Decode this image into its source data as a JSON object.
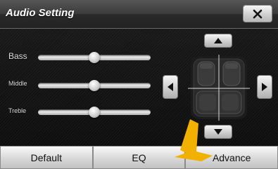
{
  "window": {
    "title": "Audio Setting"
  },
  "sliders": [
    {
      "label": "Bass",
      "value": 0.5
    },
    {
      "label": "Middle",
      "value": 0.5
    },
    {
      "label": "Treble",
      "value": 0.5
    }
  ],
  "tabs": [
    {
      "label": "Default"
    },
    {
      "label": "EQ"
    },
    {
      "label": "Advance"
    }
  ],
  "colors": {
    "pointer": "#f2b100"
  }
}
